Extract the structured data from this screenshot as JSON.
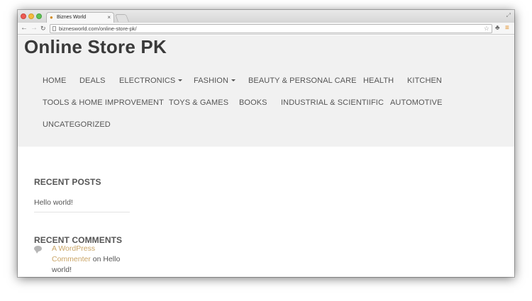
{
  "browser": {
    "tab_title": "Biznes World",
    "tab_close": "×",
    "address": "biznesworld.com/online-store-pk/",
    "icons": {
      "back": "arrow-left-icon",
      "forward": "arrow-right-icon",
      "reload": "reload-icon",
      "star": "star-icon",
      "extension": "extension-icon",
      "menu": "menu-icon",
      "fullscreen": "fullscreen-icon"
    }
  },
  "site": {
    "title": "Online Store PK",
    "nav": [
      {
        "label": "HOME"
      },
      {
        "label": "DEALS"
      },
      {
        "label": "ELECTRONICS",
        "dropdown": true
      },
      {
        "label": "FASHION",
        "dropdown": true
      },
      {
        "label": "BEAUTY & PERSONAL CARE"
      },
      {
        "label": "HEALTH"
      },
      {
        "label": "KITCHEN"
      },
      {
        "label": "TOOLS & HOME IMPROVEMENT"
      },
      {
        "label": "TOYS & GAMES"
      },
      {
        "label": "BOOKS"
      },
      {
        "label": "INDUSTRIAL & SCIENTIIFIC"
      },
      {
        "label": "AUTOMOTIVE"
      },
      {
        "label": "UNCATEGORIZED"
      }
    ]
  },
  "sidebar": {
    "recent_posts_title": "RECENT POSTS",
    "recent_posts": [
      {
        "label": "Hello world!"
      }
    ],
    "recent_comments_title": "RECENT COMMENTS",
    "comment": {
      "author": "A WordPress Commenter",
      "connector": " on ",
      "post": "Hello world!"
    }
  },
  "colors": {
    "header_bg": "#f1f1f1",
    "link_accent": "#c9a465",
    "text": "#555555"
  }
}
